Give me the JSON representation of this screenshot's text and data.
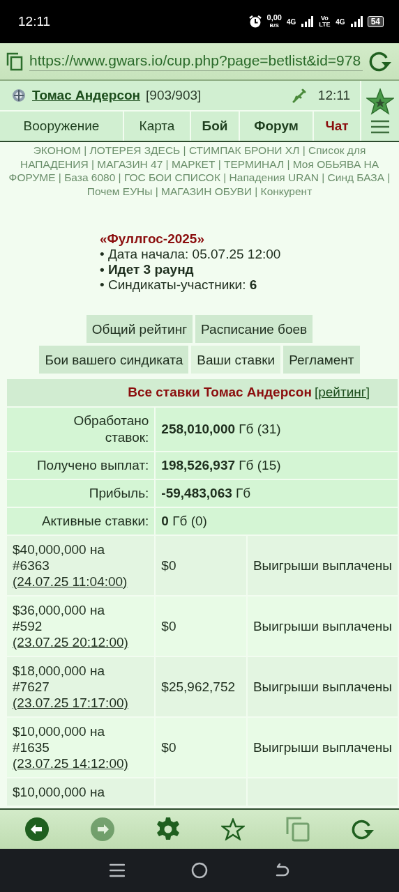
{
  "status_bar": {
    "time": "12:11",
    "data_rate": "0,00",
    "data_unit": "B/S",
    "network_1": "4G",
    "volte": "Vo LTE",
    "network_2": "4G",
    "battery": "54"
  },
  "browser": {
    "url": "https://www.gwars.io/cup.php?page=betlist&id=978"
  },
  "header": {
    "player": "Томас Андерсон",
    "hp": "[903/903]",
    "time": "12:11",
    "nav": [
      {
        "label": "Вооружение",
        "kind": "normal"
      },
      {
        "label": "Карта",
        "kind": "normal"
      },
      {
        "label": "Бой",
        "kind": "bold"
      },
      {
        "label": "Форум",
        "kind": "bold"
      },
      {
        "label": "Чат",
        "kind": "alert"
      }
    ]
  },
  "quick_links": {
    "separator": "|",
    "items": [
      "ЭКОНОМ",
      "ЛОТЕРЕЯ ЗДЕСЬ",
      "СТИМПАК БРОНИ ХЛ",
      "Список для НАПАДЕНИЯ",
      "МАГАЗИН 47",
      "МАРКЕТ",
      "ТЕРМИНАЛ",
      "Моя ОБЬЯВА НА ФОРУМЕ",
      "База 6080",
      "ГОС БОИ СПИСОК",
      "Нападения URAN",
      "Синд БАЗА",
      "Почем ЕУНы",
      "МАГАЗИН ОБУВИ",
      "Конкурент"
    ]
  },
  "tournament": {
    "title": "«Фуллгос-2025»",
    "lines": [
      {
        "text": "• Дата начала: 05.07.25 12:00",
        "bold": false
      },
      {
        "text": "• Идет 3 раунд",
        "bold": true
      },
      {
        "text": "• Синдикаты-участники: **6**",
        "bold": false
      }
    ]
  },
  "tabs": [
    [
      {
        "label": "Общий рейтинг",
        "selected": false
      },
      {
        "label": "Расписание боев",
        "selected": false
      }
    ],
    [
      {
        "label": "Бои вашего синдиката",
        "selected": false
      },
      {
        "label": "Ваши ставки",
        "selected": true
      },
      {
        "label": "Регламент",
        "selected": false
      }
    ]
  ],
  "bets_table": {
    "title": "Все ставки Томас Андерсон",
    "title_link": "[рейтинг]",
    "summary": [
      {
        "label": "Обработано ставок:",
        "amount": "258,010,000",
        "rest": "Гб (31)"
      },
      {
        "label": "Получено выплат:",
        "amount": "198,526,937",
        "rest": "Гб (15)"
      },
      {
        "label": "Прибыль:",
        "amount": "-59,483,063",
        "rest": "Гб"
      },
      {
        "label": "Активные ставки:",
        "amount": "0",
        "rest": "Гб (0)"
      }
    ],
    "rows": [
      {
        "bet": "$40,000,000 на #6363",
        "date": "(24.07.25 11:04:00)",
        "payout": "$0",
        "status": "Выигрыши выплачены"
      },
      {
        "bet": "$36,000,000 на #592",
        "date": "(23.07.25 20:12:00)",
        "payout": "$0",
        "status": "Выигрыши выплачены"
      },
      {
        "bet": "$18,000,000 на #7627",
        "date": "(23.07.25 17:17:00)",
        "payout": "$25,962,752",
        "status": "Выигрыши выплачены"
      },
      {
        "bet": "$10,000,000 на #1635",
        "date": "(23.07.25 14:12:00)",
        "payout": "$0",
        "status": "Выигрыши выплачены"
      },
      {
        "bet": "$10,000,000 на"
      }
    ]
  },
  "toolbar": [
    {
      "kind": "back",
      "disabled": false
    },
    {
      "kind": "forward",
      "disabled": true
    },
    {
      "kind": "settings",
      "disabled": false
    },
    {
      "kind": "bookmark",
      "disabled": false
    },
    {
      "kind": "tabs",
      "disabled": true
    },
    {
      "kind": "reload",
      "disabled": false
    }
  ]
}
